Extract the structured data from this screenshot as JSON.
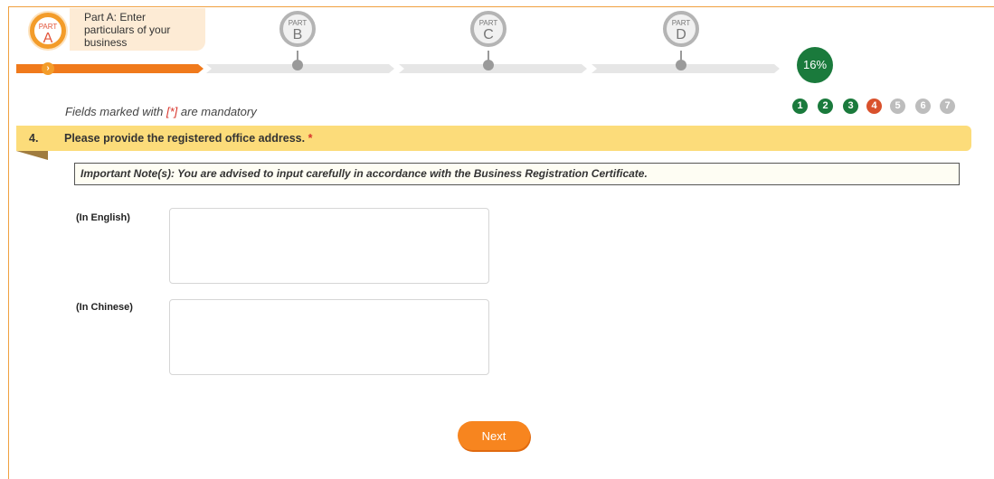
{
  "progress": {
    "parts": [
      {
        "prefix": "PART",
        "letter": "A",
        "caption": "Part A: Enter particulars of your business",
        "state": "active"
      },
      {
        "prefix": "PART",
        "letter": "B",
        "state": "inactive"
      },
      {
        "prefix": "PART",
        "letter": "C",
        "state": "inactive"
      },
      {
        "prefix": "PART",
        "letter": "D",
        "state": "inactive"
      }
    ],
    "percent": 16,
    "percent_label": "16%"
  },
  "form": {
    "mandatory_prefix": "Fields marked with ",
    "mandatory_star": "[*]",
    "mandatory_suffix": " are mandatory",
    "steps": [
      {
        "label": "1",
        "state": "done"
      },
      {
        "label": "2",
        "state": "done"
      },
      {
        "label": "3",
        "state": "done"
      },
      {
        "label": "4",
        "state": "current"
      },
      {
        "label": "5",
        "state": "todo"
      },
      {
        "label": "6",
        "state": "todo"
      },
      {
        "label": "7",
        "state": "todo"
      }
    ],
    "question_number": "4.",
    "question_text": "Please provide the registered office address.",
    "question_required_mark": "*",
    "note": "Important Note(s): You are advised to input carefully in accordance with the Business Registration Certificate.",
    "fields": [
      {
        "label": "(In English)",
        "value": ""
      },
      {
        "label": "(In Chinese)",
        "value": ""
      }
    ],
    "next_label": "Next"
  },
  "colors": {
    "accent_orange": "#f07a1c",
    "done_green": "#1a7a3c",
    "current_red": "#d9512c",
    "todo_gray": "#bdbdbd",
    "question_bar": "#fcdc7a"
  }
}
